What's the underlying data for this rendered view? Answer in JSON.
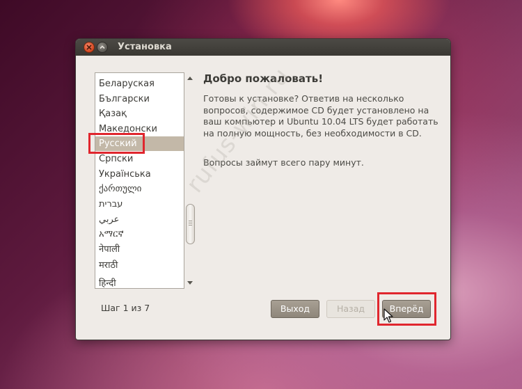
{
  "window": {
    "title": "Установка"
  },
  "languages": {
    "items": [
      "Беларуская",
      "Български",
      "Қазақ",
      "Македонски",
      "Русский",
      "Српски",
      "Українська",
      "ქართული",
      "עברית",
      "عربي",
      "አማርኛ",
      "नेपाली",
      "मराठी",
      "हिन्दी"
    ],
    "selected": "Русский"
  },
  "content": {
    "title": "Добро пожаловать!",
    "body": "Готовы к установке? Ответив на несколько вопросов, содержимое CD будет установлено на ваш компьютер и Ubuntu 10.04 LTS будет работать на полную мощность, без необходимости в CD.",
    "note": "Вопросы займут всего пару минут."
  },
  "footer": {
    "step": "Шаг 1 из 7",
    "quit": "Выход",
    "back": "Назад",
    "forward": "Вперёд"
  },
  "watermark": "rufus-win.ru",
  "colors": {
    "highlight": "#e0262e",
    "selection": "#c3b8a8"
  }
}
